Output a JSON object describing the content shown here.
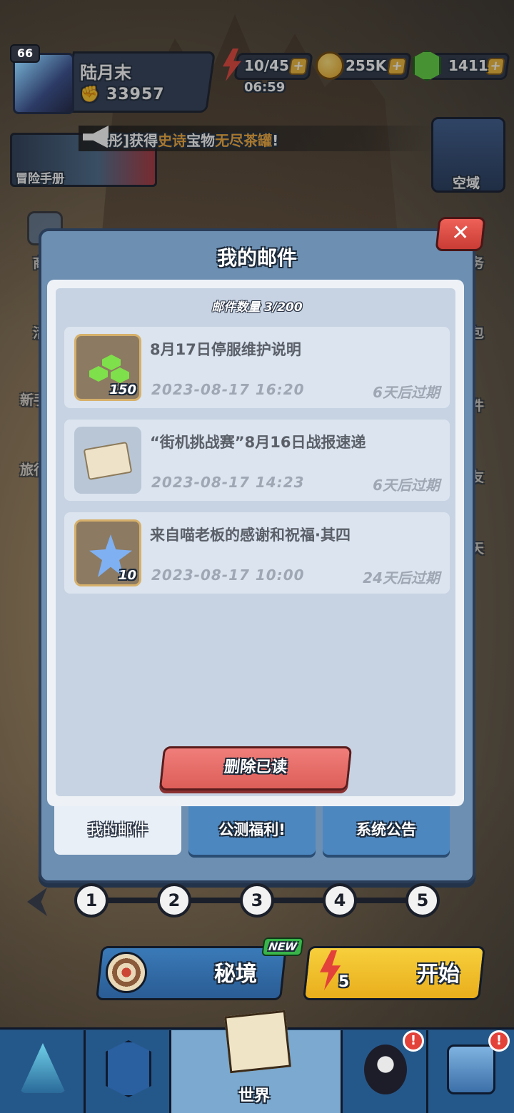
{
  "player": {
    "level": "66",
    "name": "陆月末",
    "power": "33957"
  },
  "resources": {
    "energy": "10/45",
    "energy_timer": "06:59",
    "coins": "255K",
    "gems": "1411",
    "plus": "+"
  },
  "banner": {
    "handbook": "冒险手册",
    "announce_prefix": "彤]获得",
    "announce_tier": "史诗",
    "announce_mid": "宝物",
    "announce_item": "无尽茶罐",
    "announce_suffix": "!",
    "realm": "空域"
  },
  "side_left": [
    "商城",
    "活",
    "新手",
    "旅行"
  ],
  "side_right": [
    "任务",
    "背包",
    "邮件",
    "好友",
    "聊天"
  ],
  "modal": {
    "title": "我的邮件",
    "close": "✕",
    "mail_count": "邮件数量 3/200",
    "mails": [
      {
        "title": "8月17日停服维护说明",
        "date": "2023-08-17 16:20",
        "expire": "6天后过期",
        "icon": "green-gems-icon",
        "qty": "150"
      },
      {
        "title": "“街机挑战赛”8月16日战报速递",
        "date": "2023-08-17 14:23",
        "expire": "6天后过期",
        "icon": "envelope-icon",
        "qty": ""
      },
      {
        "title": "来自喵老板的感谢和祝福·其四",
        "date": "2023-08-17 10:00",
        "expire": "24天后过期",
        "icon": "blue-star-crystal-icon",
        "qty": "10"
      }
    ],
    "delete_read": "删除已读",
    "tabs": [
      "我的邮件",
      "公测福利!",
      "系统公告"
    ]
  },
  "stages": [
    "1",
    "2",
    "3",
    "4",
    "5"
  ],
  "actions": {
    "secret_realm": "秘境",
    "new_badge": "NEW",
    "start": "开始",
    "start_cost": "5"
  },
  "nav": {
    "world": "世界",
    "badge": "!"
  },
  "colors": {
    "accent_blue": "#6c8fb2",
    "delete_red": "#dd5e59",
    "start_yellow": "#f7cf3c",
    "announce_gold": "#f3a93a"
  }
}
